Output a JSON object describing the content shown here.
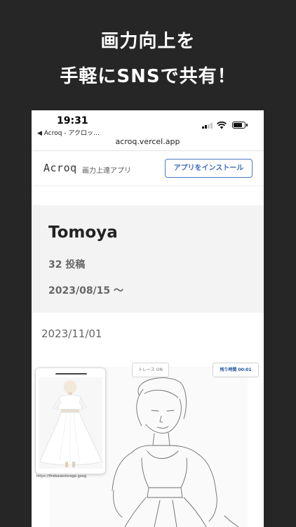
{
  "promo": {
    "line1": "画力向上を",
    "line2": "手軽にSNSで共有！"
  },
  "status_bar": {
    "time": "19:31",
    "back_label": "◀ Acroq - アクロッ…",
    "url": "acroq.vercel.app",
    "icons": [
      "cellular-signal-icon",
      "wifi-icon",
      "battery-icon"
    ]
  },
  "app_header": {
    "logo": "Acroq",
    "tagline": "画力上達アプリ",
    "install_label": "アプリをインストール",
    "accent": "#3f6fbd"
  },
  "profile": {
    "name": "Tomoya",
    "posts": "32 投稿",
    "since": "2023/08/15 〜"
  },
  "post": {
    "date": "2023/11/01",
    "trace_label": "トレース ON",
    "timer_label": "残り時間 00:01",
    "reference_source": "https://firebasestorage.goog"
  }
}
